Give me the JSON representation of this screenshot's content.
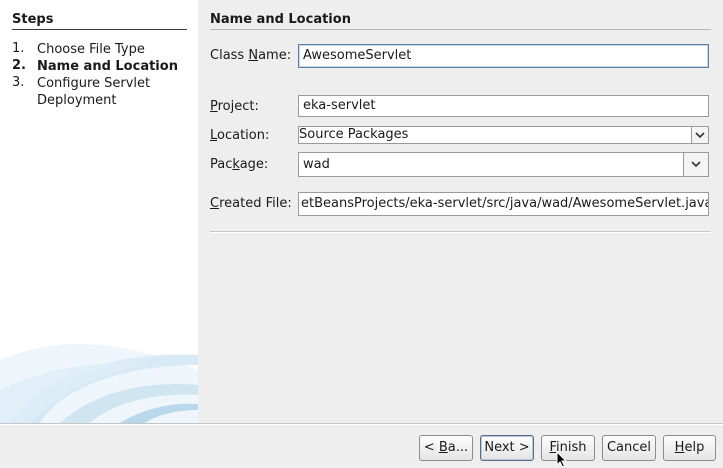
{
  "steps": {
    "title": "Steps",
    "items": [
      {
        "num": "1.",
        "label": "Choose File Type"
      },
      {
        "num": "2.",
        "label": "Name and Location"
      },
      {
        "num": "3.",
        "label": "Configure Servlet Deployment"
      }
    ]
  },
  "panel": {
    "title": "Name and Location",
    "class_name": {
      "label_pre": "Class ",
      "label_mn": "N",
      "label_post": "ame:",
      "value": "AwesomeServlet"
    },
    "project": {
      "label_mn": "P",
      "label_post": "roject:",
      "value": "eka-servlet"
    },
    "location": {
      "label_mn": "L",
      "label_post": "ocation:",
      "value": "Source Packages"
    },
    "package": {
      "label_pre": "Pac",
      "label_mn": "k",
      "label_post": "age:",
      "value": "wad"
    },
    "created_file": {
      "label_mn": "C",
      "label_post": "reated File:",
      "value": "etBeansProjects/eka-servlet/src/java/wad/AwesomeServlet.java"
    }
  },
  "buttons": {
    "back": {
      "pre": "< ",
      "mn": "B",
      "post": "a..."
    },
    "next": "Next >",
    "finish": {
      "mn": "F",
      "post": "inish"
    },
    "cancel": "Cancel",
    "help": {
      "mn": "H",
      "post": "elp"
    }
  },
  "colors": {
    "accent": "#5b7fa8",
    "sidebar_bg": "#ffffff",
    "panel_bg": "#eeeeee"
  }
}
